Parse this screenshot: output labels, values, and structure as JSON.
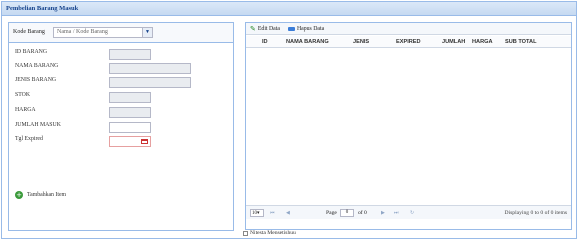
{
  "window": {
    "title": "Pembelian Barang Masuk"
  },
  "search": {
    "label": "Kode Barang",
    "placeholder": "Nama / Kode Barang"
  },
  "form": {
    "fields": [
      {
        "label": "ID BARANG"
      },
      {
        "label": "NAMA BARANG"
      },
      {
        "label": "JENIS BARANG"
      },
      {
        "label": "STOK"
      },
      {
        "label": "HARGA"
      },
      {
        "label": "JUMLAH MASUK"
      },
      {
        "label": "Tgl Expired"
      }
    ],
    "add_button": "Tambahkan Item"
  },
  "grid": {
    "toolbar": {
      "edit": "Edit Data",
      "delete": "Hapus Data"
    },
    "columns": [
      "ID",
      "NAMA BARANG",
      "JENIS",
      "EXPIRED",
      "JUMLAH",
      "HARGA",
      "SUB TOTAL"
    ],
    "pager": {
      "page_size": "10",
      "page_label": "Page",
      "page_value": "0",
      "of_label": "of 0",
      "display": "Displaying 0 to 0 of 0 items"
    }
  },
  "footer": {
    "checkbox_label": "Nitesta Mensetishuu"
  }
}
